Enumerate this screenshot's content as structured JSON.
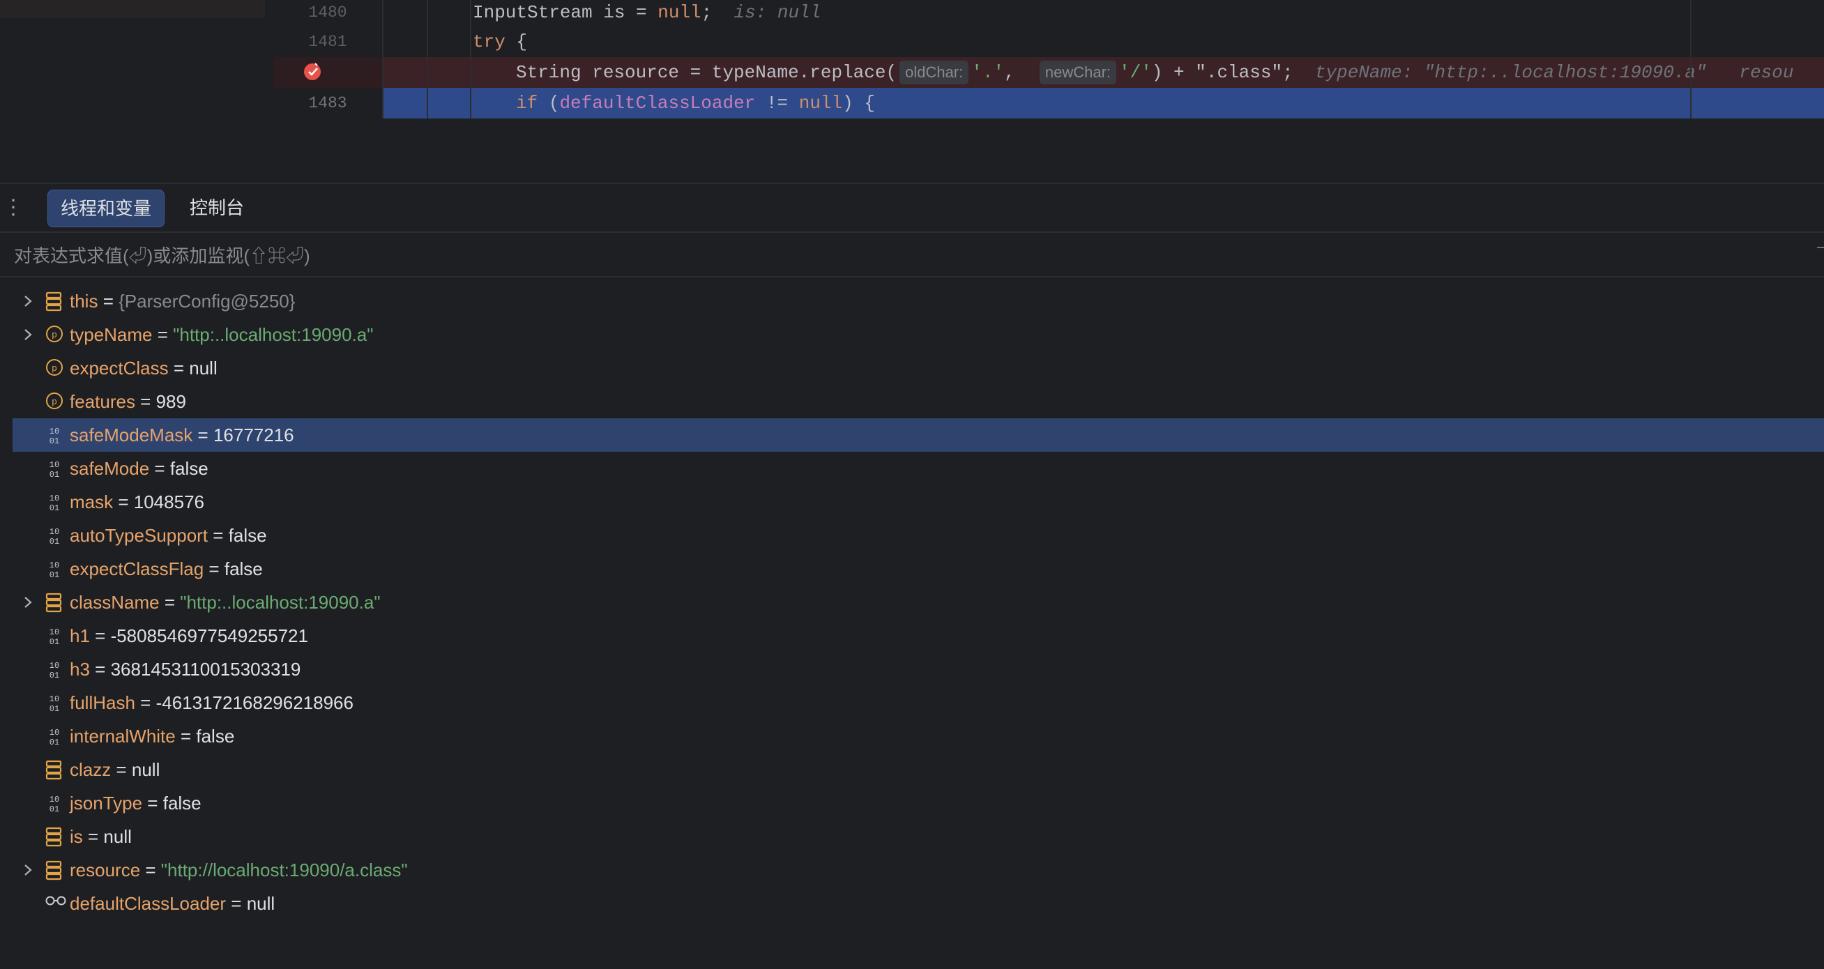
{
  "editor": {
    "lines": [
      {
        "number": "1480",
        "code": "InputStream is = null;",
        "hint": "is: null"
      },
      {
        "number": "1481",
        "code": "try {"
      },
      {
        "number": "",
        "code_prefix": "String resource = typeName.replace(",
        "param1_hint": "oldChar:",
        "arg1": "'.'",
        "param2_hint": "newChar:",
        "arg2": "'/'",
        "code_suffix": ") + \".class\";",
        "hint": "typeName: \"http:..localhost:19090.a\"",
        "hint2": "resou"
      },
      {
        "number": "1483",
        "code_kw": "if",
        "code_field": "defaultClassLoader",
        "code_rest": " != ",
        "code_null": "null",
        "code_end": ") {"
      }
    ]
  },
  "debug": {
    "tabs": [
      {
        "label": "线程和变量",
        "active": true
      },
      {
        "label": "控制台",
        "active": false
      }
    ],
    "eval_placeholder": "对表达式求值(⏎)或添加监视(⇧⌘⏎)",
    "variables": [
      {
        "name": "this",
        "value": "{ParserConfig@5250}",
        "kind": "obj",
        "icon": "field-icon",
        "expandable": true
      },
      {
        "name": "typeName",
        "value": "\"http:..localhost:19090.a\"",
        "kind": "str",
        "icon": "parameter-icon",
        "expandable": true
      },
      {
        "name": "expectClass",
        "value": "null",
        "kind": "plain",
        "icon": "parameter-icon",
        "expandable": false
      },
      {
        "name": "features",
        "value": "989",
        "kind": "plain",
        "icon": "parameter-icon",
        "expandable": false
      },
      {
        "name": "safeModeMask",
        "value": "16777216",
        "kind": "plain",
        "icon": "primitive-icon",
        "expandable": false,
        "selected": true
      },
      {
        "name": "safeMode",
        "value": "false",
        "kind": "plain",
        "icon": "primitive-icon",
        "expandable": false
      },
      {
        "name": "mask",
        "value": "1048576",
        "kind": "plain",
        "icon": "primitive-icon",
        "expandable": false
      },
      {
        "name": "autoTypeSupport",
        "value": "false",
        "kind": "plain",
        "icon": "primitive-icon",
        "expandable": false
      },
      {
        "name": "expectClassFlag",
        "value": "false",
        "kind": "plain",
        "icon": "primitive-icon",
        "expandable": false
      },
      {
        "name": "className",
        "value": "\"http:..localhost:19090.a\"",
        "kind": "str",
        "icon": "field-icon",
        "expandable": true
      },
      {
        "name": "h1",
        "value": "-5808546977549255721",
        "kind": "plain",
        "icon": "primitive-icon",
        "expandable": false
      },
      {
        "name": "h3",
        "value": "3681453110015303319",
        "kind": "plain",
        "icon": "primitive-icon",
        "expandable": false
      },
      {
        "name": "fullHash",
        "value": "-4613172168296218966",
        "kind": "plain",
        "icon": "primitive-icon",
        "expandable": false
      },
      {
        "name": "internalWhite",
        "value": "false",
        "kind": "plain",
        "icon": "primitive-icon",
        "expandable": false
      },
      {
        "name": "clazz",
        "value": "null",
        "kind": "plain",
        "icon": "field-icon",
        "expandable": false
      },
      {
        "name": "jsonType",
        "value": "false",
        "kind": "plain",
        "icon": "primitive-icon",
        "expandable": false
      },
      {
        "name": "is",
        "value": "null",
        "kind": "plain",
        "icon": "field-icon",
        "expandable": false
      },
      {
        "name": "resource",
        "value": "\"http://localhost:19090/a.class\"",
        "kind": "str",
        "icon": "field-icon",
        "expandable": true
      },
      {
        "name": "defaultClassLoader",
        "value": "null",
        "kind": "plain",
        "icon": "watch-icon",
        "expandable": false
      }
    ]
  },
  "colors": {
    "background": "#1e1f22",
    "selection": "#2e436e",
    "execution_line": "#2e4a8a",
    "breakpoint_line": "#3a2226",
    "var_name": "#e6a36b",
    "string_value": "#6aab73",
    "keyword": "#cf8e6d"
  }
}
